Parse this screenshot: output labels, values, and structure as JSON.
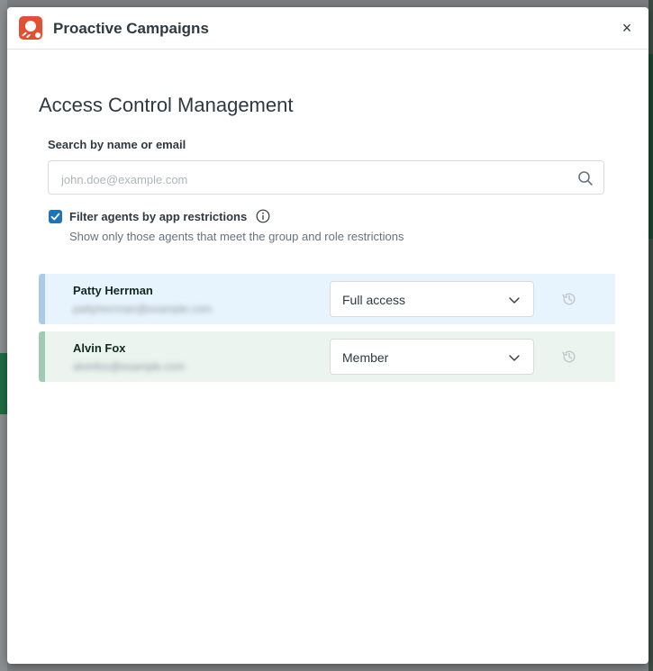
{
  "app": {
    "title": "Proactive Campaigns",
    "close_symbol": "×",
    "brand_color": "#e34f32"
  },
  "page": {
    "title": "Access Control Management"
  },
  "search": {
    "label": "Search by name or email",
    "placeholder": "john.doe@example.com",
    "value": "",
    "icon": "search-icon"
  },
  "filter": {
    "checked": true,
    "label": "Filter agents by app restrictions",
    "hint": "Show only those agents that meet the group and role restrictions",
    "icon": "info-icon"
  },
  "agents": [
    {
      "name": "Patty Herrman",
      "email": "pattyherrman@example.com",
      "role": "Full access",
      "row_color": "#e8f4fd",
      "accent_color": "#a8cbe8"
    },
    {
      "name": "Alvin Fox",
      "email": "alvinfox@example.com",
      "role": "Member",
      "row_color": "#ebf4ef",
      "accent_color": "#9fcbb5"
    }
  ]
}
